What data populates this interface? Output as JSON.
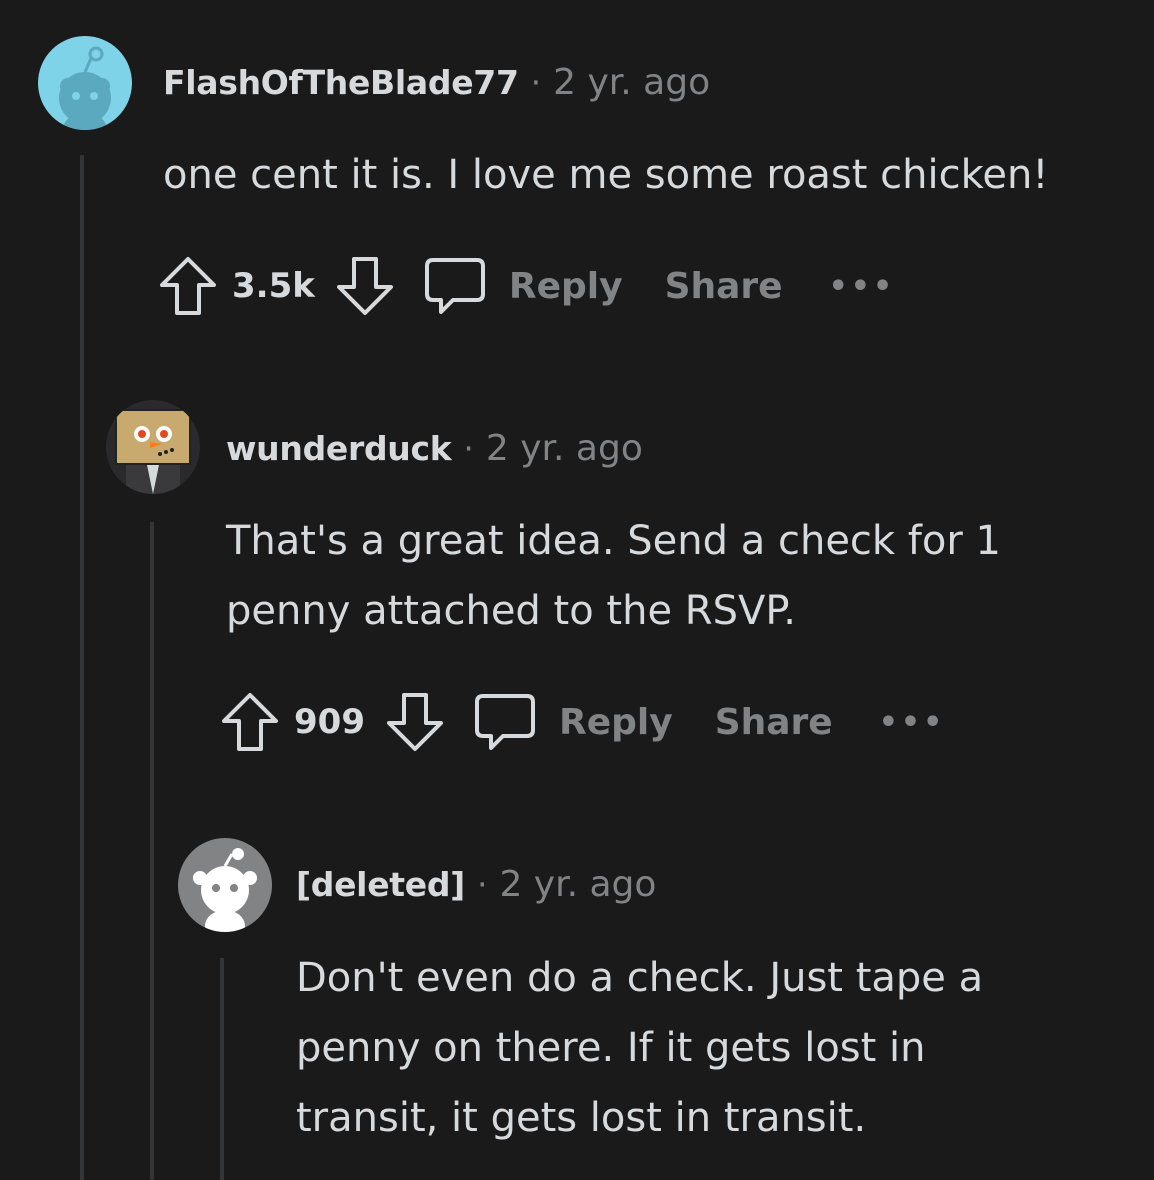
{
  "comments": [
    {
      "username": "FlashOfTheBlade77",
      "separator": "·",
      "time": "2 yr. ago",
      "text_lines": [
        "one cent it is. I love me some roast chicken!"
      ],
      "votes": "3.5k",
      "reply_label": "Reply",
      "share_label": "Share",
      "more_label": "•••"
    },
    {
      "username": "wunderduck",
      "separator": "·",
      "time": "2 yr. ago",
      "text_lines": [
        "That's a great idea. Send a check for 1",
        "penny attached to the RSVP."
      ],
      "votes": "909",
      "reply_label": "Reply",
      "share_label": "Share",
      "more_label": "•••"
    },
    {
      "username": "[deleted]",
      "separator": "·",
      "time": "2 yr. ago",
      "text_lines": [
        "Don't even do a check. Just tape a",
        "penny on there. If it gets lost in",
        "transit, it gets lost in transit."
      ]
    }
  ],
  "colors": {
    "background": "#1a1a1b",
    "text": "#d7dadc",
    "muted": "#818384",
    "thread_line": "#343536",
    "avatar1_bg": "#7fd3e8",
    "avatar3_bg": "#818384"
  }
}
